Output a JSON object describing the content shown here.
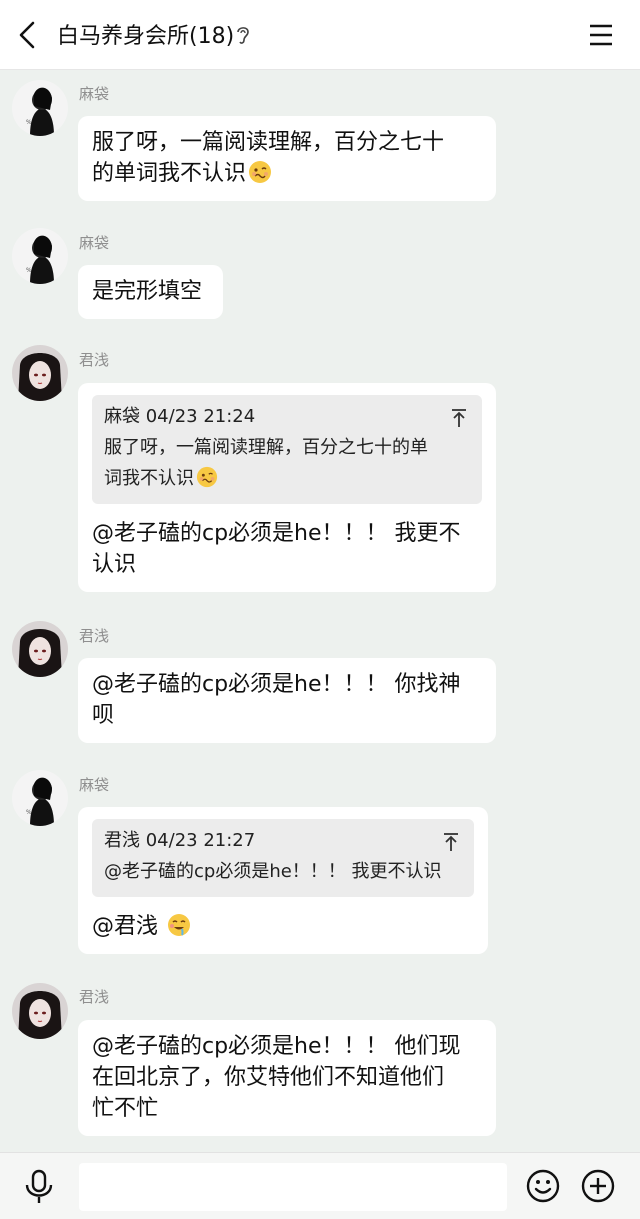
{
  "header": {
    "title": "白马养身会所(18)"
  },
  "messages": [
    {
      "sender": "麻袋",
      "text_lines": [
        "服了呀，一篇阅读理解，百分之七十",
        "的单词我不认识"
      ],
      "emoji": "woozy-face"
    },
    {
      "sender": "麻袋",
      "text_lines": [
        "是完形填空"
      ]
    },
    {
      "sender": "君浅",
      "quote": {
        "header": "麻袋 04/23 21:24",
        "lines": [
          "服了呀，一篇阅读理解，百分之七十的单",
          "词我不认识"
        ],
        "emoji": "woozy-face"
      },
      "text_lines": [
        "@老子磕的cp必须是he！！！ 我更不",
        "认识"
      ]
    },
    {
      "sender": "君浅",
      "text_lines": [
        "@老子磕的cp必须是he！！！ 你找神",
        "呗"
      ]
    },
    {
      "sender": "麻袋",
      "quote": {
        "header": "君浅 04/23 21:27",
        "lines": [
          "@老子磕的cp必须是he！！！ 我更不认识"
        ]
      },
      "text_lines": [
        "@君浅 "
      ],
      "emoji": "drooling-face"
    },
    {
      "sender": "君浅",
      "text_lines": [
        "@老子磕的cp必须是he！！！ 他们现",
        "在回北京了，你艾特他们不知道他们",
        "忙不忙"
      ]
    }
  ],
  "colors": {
    "background": "#edf1ee",
    "bubble": "#ffffff",
    "quote_bg": "#ececec",
    "sender_name": "#8f8f8f"
  },
  "icons": [
    "back-arrow-icon",
    "ear-icon",
    "menu-icon",
    "top-arrow-icon",
    "microphone-icon",
    "smiley-icon",
    "plus-circle-icon"
  ]
}
